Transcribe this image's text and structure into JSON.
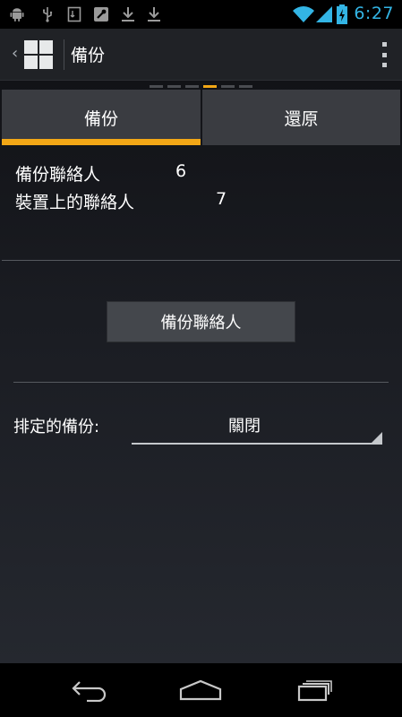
{
  "status_bar": {
    "time": "6:27",
    "icons": [
      "android-icon",
      "usb-icon",
      "sd-card-icon",
      "wrench-icon",
      "download-icon",
      "download-icon",
      "wifi-icon",
      "signal-icon",
      "battery-charging-icon"
    ],
    "accent_color": "#33b5e5"
  },
  "action_bar": {
    "title": "備份",
    "app_icon": "windows-grid-icon",
    "menu_icon": "overflow-menu-icon"
  },
  "page_indicator": {
    "count": 6,
    "active_index": 3,
    "active_color": "#f2a716"
  },
  "tabs": [
    {
      "label": "備份",
      "selected": true
    },
    {
      "label": "還原",
      "selected": false
    }
  ],
  "info": {
    "backup_contacts_label": "備份聯絡人",
    "backup_contacts_value": "6",
    "device_contacts_label": "裝置上的聯絡人",
    "device_contacts_value": "7"
  },
  "backup_button_label": "備份聯絡人",
  "schedule": {
    "label": "排定的備份:",
    "value": "關閉"
  },
  "nav_bar": {
    "icons": [
      "back-icon",
      "home-icon",
      "recent-apps-icon"
    ]
  }
}
